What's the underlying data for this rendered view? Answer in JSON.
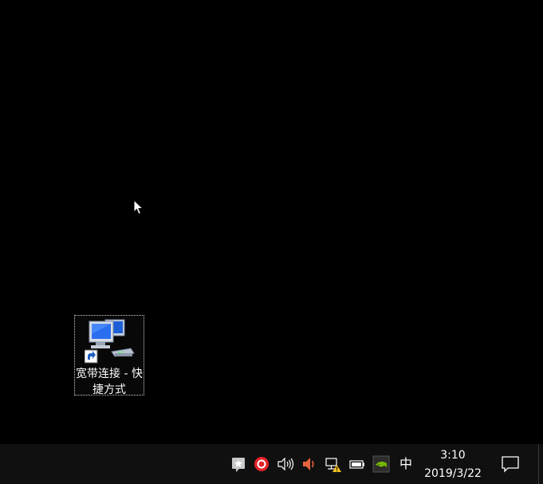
{
  "desktop": {
    "shortcut": {
      "label": "宽带连接 - 快捷方式",
      "icon": "network-connection-icon"
    }
  },
  "taskbar": {
    "tray_icons": [
      "star-notification-icon",
      "red-ring-app-icon",
      "speaker-icon",
      "speaker-muted-orange-icon",
      "network-warning-icon",
      "battery-icon",
      "nvidia-icon"
    ],
    "ime": "中",
    "clock": {
      "time": "3:10",
      "date": "2019/3/22"
    },
    "action_center_icon": "notification-bubble-icon"
  }
}
